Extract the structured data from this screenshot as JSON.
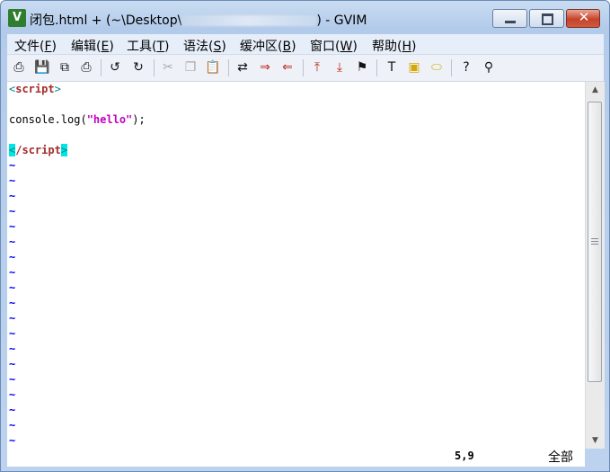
{
  "window": {
    "title_prefix": "闭包.html + (~\\Desktop\\",
    "title_suffix": ") - GVIM",
    "close_glyph": "✕"
  },
  "menu": [
    {
      "label": "文件(",
      "key": "F",
      "end": ")"
    },
    {
      "label": "编辑(",
      "key": "E",
      "end": ")"
    },
    {
      "label": "工具(",
      "key": "T",
      "end": ")"
    },
    {
      "label": "语法(",
      "key": "S",
      "end": ")"
    },
    {
      "label": "缓冲区(",
      "key": "B",
      "end": ")"
    },
    {
      "label": "窗口(",
      "key": "W",
      "end": ")"
    },
    {
      "label": "帮助(",
      "key": "H",
      "end": ")"
    }
  ],
  "toolbar": [
    {
      "icon": "open-file-icon",
      "glyph": "⎙"
    },
    {
      "icon": "save-icon",
      "glyph": "💾"
    },
    {
      "icon": "save-all-icon",
      "glyph": "⧉"
    },
    {
      "icon": "print-icon",
      "glyph": "⎙"
    },
    {
      "icon": "undo-icon",
      "glyph": "↺"
    },
    {
      "icon": "redo-icon",
      "glyph": "↻"
    },
    {
      "icon": "cut-icon",
      "glyph": "✂"
    },
    {
      "icon": "copy-icon",
      "glyph": "❐"
    },
    {
      "icon": "paste-icon",
      "glyph": "📋"
    },
    {
      "icon": "replace-icon",
      "glyph": "⇄"
    },
    {
      "icon": "find-next-icon",
      "glyph": "⇒"
    },
    {
      "icon": "find-prev-icon",
      "glyph": "⇐"
    },
    {
      "icon": "load-session-icon",
      "glyph": "⤒"
    },
    {
      "icon": "save-session-icon",
      "glyph": "⤓"
    },
    {
      "icon": "run-script-icon",
      "glyph": "⚑"
    },
    {
      "icon": "make-icon",
      "glyph": "T"
    },
    {
      "icon": "shell-icon",
      "glyph": "▣"
    },
    {
      "icon": "tag-jump-icon",
      "glyph": "⬭"
    },
    {
      "icon": "help-icon",
      "glyph": "?"
    },
    {
      "icon": "find-help-icon",
      "glyph": "⚲"
    }
  ],
  "editor": {
    "line1_open": "<",
    "line1_tag": "script",
    "line1_close": ">",
    "line3_code": "console.log(",
    "line3_string": "\"hello\"",
    "line3_end": ");",
    "line5_cursor": "<",
    "line5_slash": "/",
    "line5_tag": "script",
    "line5_close": ">",
    "tilde": "~"
  },
  "status": {
    "position": "5,9",
    "scroll": "全部"
  },
  "scrollbar": {
    "up_glyph": "▲",
    "down_glyph": "▼"
  }
}
